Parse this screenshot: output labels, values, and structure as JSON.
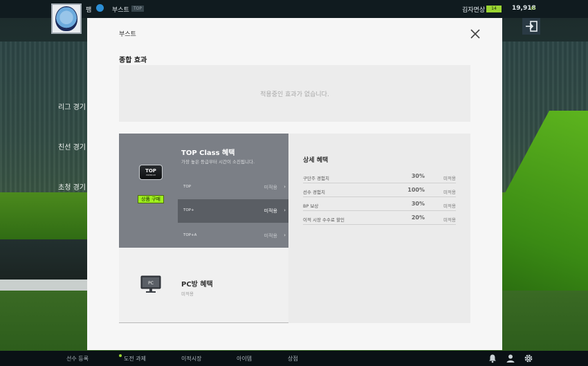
{
  "topbar": {
    "team_name": "팸",
    "boost_label": "부스트",
    "boost_tag": "TOP",
    "manager_name": "김자면상",
    "level": "14",
    "coins": "19,918",
    "coin_unit": "$5"
  },
  "left_menu": [
    "리그 경기",
    "친선 경기",
    "초청 경기"
  ],
  "modal": {
    "title": "부스트",
    "summary_title": "종합 효과",
    "summary_empty": "적용중인 효과가 없습니다.",
    "top_class": {
      "title": "TOP Class 혜택",
      "subtitle": "가장 높은 등급부터 시간이 소진됩니다.",
      "logo_text": "TOP",
      "logo_sub": "PREMIUM",
      "buy_label": "상품 구매",
      "tiers": [
        {
          "name": "TOP",
          "status": "미적용",
          "selected": false
        },
        {
          "name": "TOP+",
          "status": "미적용",
          "selected": true
        },
        {
          "name": "TOP+A",
          "status": "미적용",
          "selected": false
        }
      ]
    },
    "pc_room": {
      "icon_text": "PC",
      "title": "PC방 혜택",
      "status": "미적용"
    },
    "detail": {
      "title": "상세 혜택",
      "rows": [
        {
          "label": "구단주 경험치",
          "value": "30%",
          "status": "미적용"
        },
        {
          "label": "선수 경험치",
          "value": "100%",
          "status": "미적용"
        },
        {
          "label": "BP 보상",
          "value": "30%",
          "status": "미적용"
        },
        {
          "label": "이적 시장 수수료 할인",
          "value": "20%",
          "status": "미적용"
        }
      ]
    }
  },
  "bottombar": {
    "items": [
      "선수 등록",
      "도전 과제",
      "이적시장",
      "아이템",
      "상점"
    ]
  },
  "colors": {
    "accent_green": "#9ff01c",
    "card_gray": "#7b7f86",
    "selected_tier": "#5a5e64"
  }
}
